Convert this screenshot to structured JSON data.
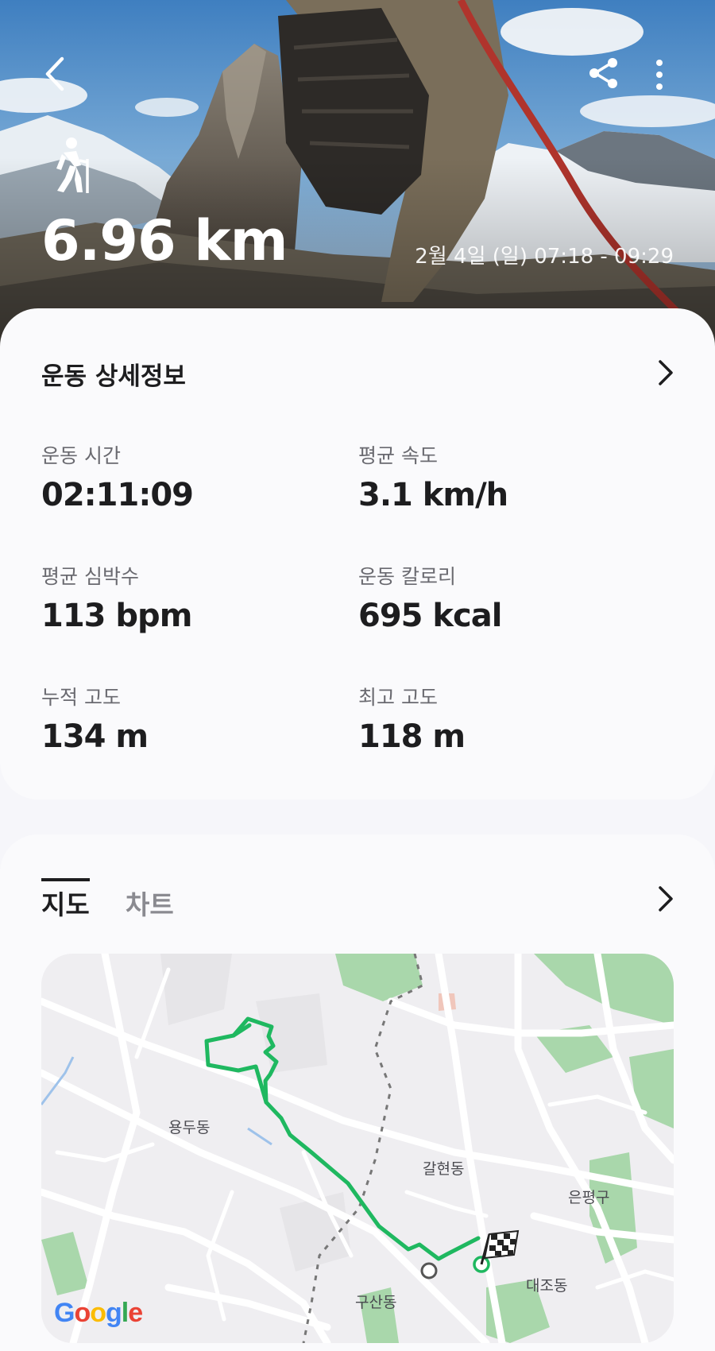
{
  "header": {
    "distance": "6.96 km",
    "datetime": "2월 4일 (일) 07:18 - 09:29",
    "back_icon": "chevron-left-icon",
    "share_icon": "share-icon",
    "more_icon": "more-vertical-icon",
    "activity_icon": "hiking-icon"
  },
  "details": {
    "title": "운동 상세정보",
    "stats": [
      {
        "label": "운동 시간",
        "value": "02:11:09"
      },
      {
        "label": "평균 속도",
        "value": "3.1 km/h"
      },
      {
        "label": "평균 심박수",
        "value": "113 bpm"
      },
      {
        "label": "운동 칼로리",
        "value": "695 kcal"
      },
      {
        "label": "누적 고도",
        "value": "134 m"
      },
      {
        "label": "최고 고도",
        "value": "118 m"
      }
    ]
  },
  "map_section": {
    "tabs": [
      {
        "label": "지도",
        "active": true
      },
      {
        "label": "차트",
        "active": false
      }
    ],
    "places": [
      "용두동",
      "갈현동",
      "은평구",
      "대조동",
      "구산동"
    ],
    "route_color": "#1fb860",
    "attribution": "Google"
  }
}
